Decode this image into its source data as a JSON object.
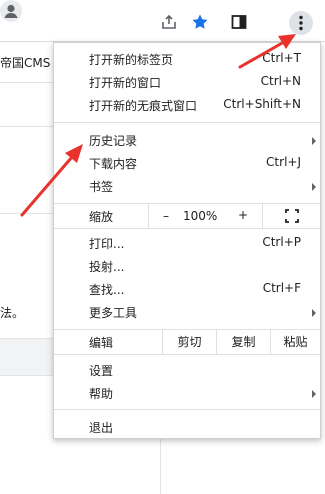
{
  "page": {
    "bookmark_fragment": "帝国CMS",
    "body_fragment": "法。"
  },
  "toolbar": {
    "icons": [
      "share-icon",
      "star-icon",
      "side-panel-icon",
      "profile-icon",
      "more-vert-icon"
    ],
    "accent": "#1a73e8"
  },
  "menu": {
    "new_tab": {
      "label": "打开新的标签页",
      "shortcut": "Ctrl+T"
    },
    "new_window": {
      "label": "打开新的窗口",
      "shortcut": "Ctrl+N"
    },
    "new_incognito": {
      "label": "打开新的无痕式窗口",
      "shortcut": "Ctrl+Shift+N"
    },
    "history": {
      "label": "历史记录"
    },
    "downloads": {
      "label": "下载内容",
      "shortcut": "Ctrl+J"
    },
    "bookmarks": {
      "label": "书签"
    },
    "zoom": {
      "label": "缩放",
      "minus": "–",
      "value": "100%",
      "plus": "+"
    },
    "print": {
      "label": "打印...",
      "shortcut": "Ctrl+P"
    },
    "cast": {
      "label": "投射..."
    },
    "find": {
      "label": "查找...",
      "shortcut": "Ctrl+F"
    },
    "more_tools": {
      "label": "更多工具"
    },
    "edit": {
      "label": "编辑",
      "cut": "剪切",
      "copy": "复制",
      "paste": "粘贴"
    },
    "settings": {
      "label": "设置"
    },
    "help": {
      "label": "帮助"
    },
    "exit": {
      "label": "退出"
    }
  },
  "annotation_color": "#e8322b"
}
